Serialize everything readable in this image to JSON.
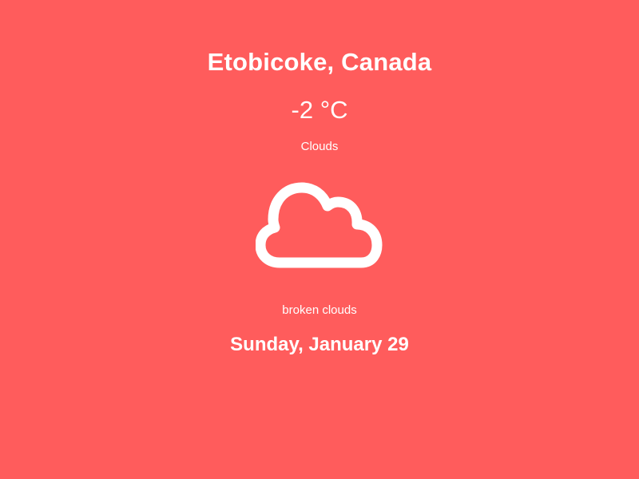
{
  "colors": {
    "background": "#ff5c5c",
    "foreground": "#ffffff"
  },
  "weather": {
    "location": "Etobicoke, Canada",
    "temperature": "-2 °C",
    "condition": "Clouds",
    "icon": "cloud-icon",
    "description": "broken clouds",
    "date": "Sunday, January 29"
  }
}
